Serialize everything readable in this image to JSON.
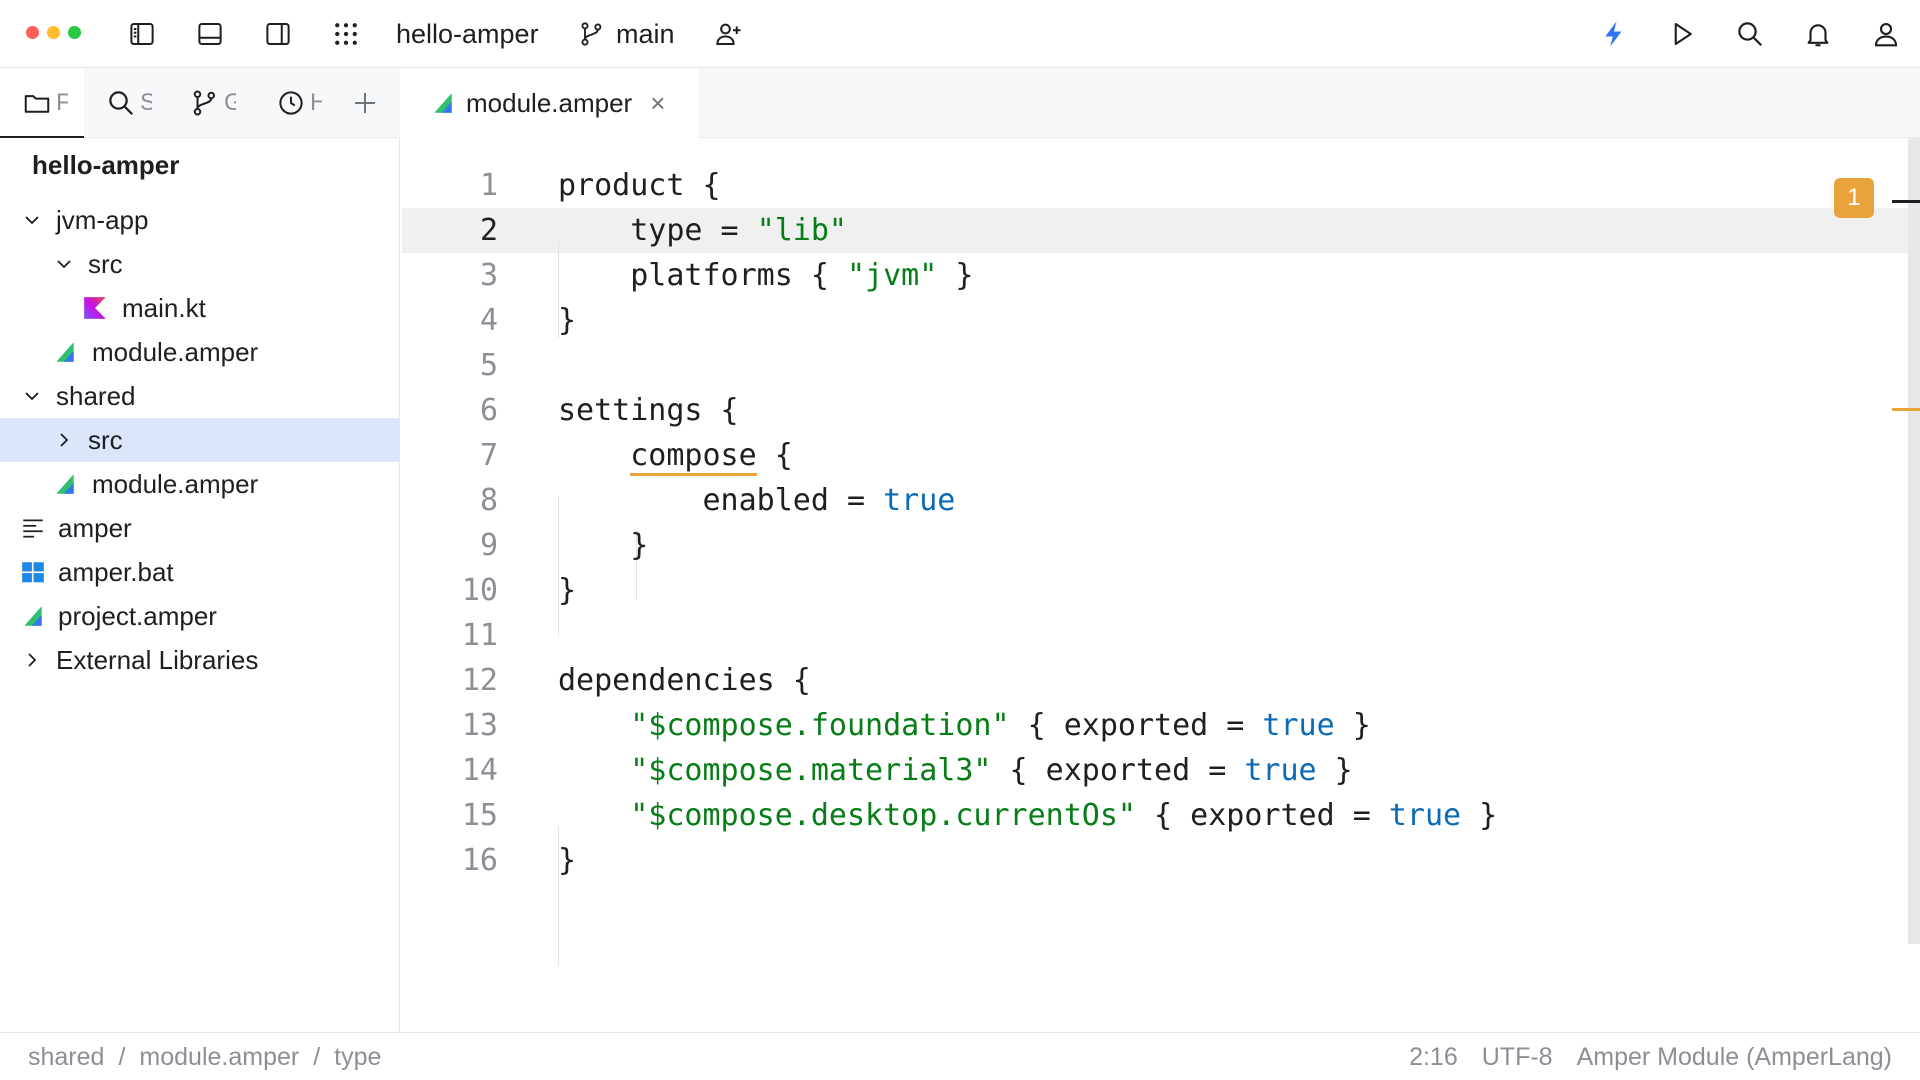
{
  "window": {
    "project_name": "hello-amper",
    "branch": "main"
  },
  "tool_tabs": [
    {
      "name": "project",
      "label": "F"
    },
    {
      "name": "search",
      "label": "S"
    },
    {
      "name": "git",
      "label": "G"
    },
    {
      "name": "history",
      "label": "H"
    }
  ],
  "tree": {
    "root": "hello-amper",
    "items": [
      {
        "label": "jvm-app"
      },
      {
        "label": "src"
      },
      {
        "label": "main.kt"
      },
      {
        "label": "module.amper"
      },
      {
        "label": "shared"
      },
      {
        "label": "src"
      },
      {
        "label": "module.amper"
      },
      {
        "label": "amper"
      },
      {
        "label": "amper.bat"
      },
      {
        "label": "project.amper"
      },
      {
        "label": "External Libraries"
      }
    ]
  },
  "editor": {
    "tab_label": "module.amper",
    "tab_close": "×",
    "warning_count": "1",
    "line_numbers": [
      "1",
      "2",
      "3",
      "4",
      "5",
      "6",
      "7",
      "8",
      "9",
      "10",
      "11",
      "12",
      "13",
      "14",
      "15",
      "16"
    ],
    "lines": [
      [
        {
          "t": "product {"
        }
      ],
      [
        {
          "t": "    type = "
        },
        {
          "t": "\"lib\"",
          "c": "str"
        }
      ],
      [
        {
          "t": "    platforms { "
        },
        {
          "t": "\"jvm\"",
          "c": "str"
        },
        {
          "t": " }"
        }
      ],
      [
        {
          "t": "}"
        }
      ],
      [
        {
          "t": ""
        }
      ],
      [
        {
          "t": "settings {"
        }
      ],
      [
        {
          "t": "    "
        },
        {
          "t": "compose",
          "c": "warn"
        },
        {
          "t": " {"
        }
      ],
      [
        {
          "t": "        enabled = "
        },
        {
          "t": "true",
          "c": "kw"
        }
      ],
      [
        {
          "t": "    }"
        }
      ],
      [
        {
          "t": "}"
        }
      ],
      [
        {
          "t": ""
        }
      ],
      [
        {
          "t": "dependencies {"
        }
      ],
      [
        {
          "t": "    "
        },
        {
          "t": "\"$compose.foundation\"",
          "c": "str"
        },
        {
          "t": " { exported = "
        },
        {
          "t": "true",
          "c": "kw"
        },
        {
          "t": " }"
        }
      ],
      [
        {
          "t": "    "
        },
        {
          "t": "\"$compose.material3\"",
          "c": "str"
        },
        {
          "t": " { exported = "
        },
        {
          "t": "true",
          "c": "kw"
        },
        {
          "t": " }"
        }
      ],
      [
        {
          "t": "    "
        },
        {
          "t": "\"$compose.desktop.currentOs\"",
          "c": "str"
        },
        {
          "t": " { exported = "
        },
        {
          "t": "true",
          "c": "kw"
        },
        {
          "t": " }"
        }
      ],
      [
        {
          "t": "}"
        }
      ]
    ]
  },
  "status": {
    "crumbs": [
      "shared",
      "module.amper",
      "type"
    ],
    "separator": "/",
    "position": "2:16",
    "encoding": "UTF-8",
    "language": "Amper Module (AmperLang)"
  },
  "colors": {
    "accent": "#3574f0",
    "selection": "#dbe6fb",
    "string": "#067d17",
    "keyword": "#0b6bb5",
    "warning": "#e8a43a"
  }
}
